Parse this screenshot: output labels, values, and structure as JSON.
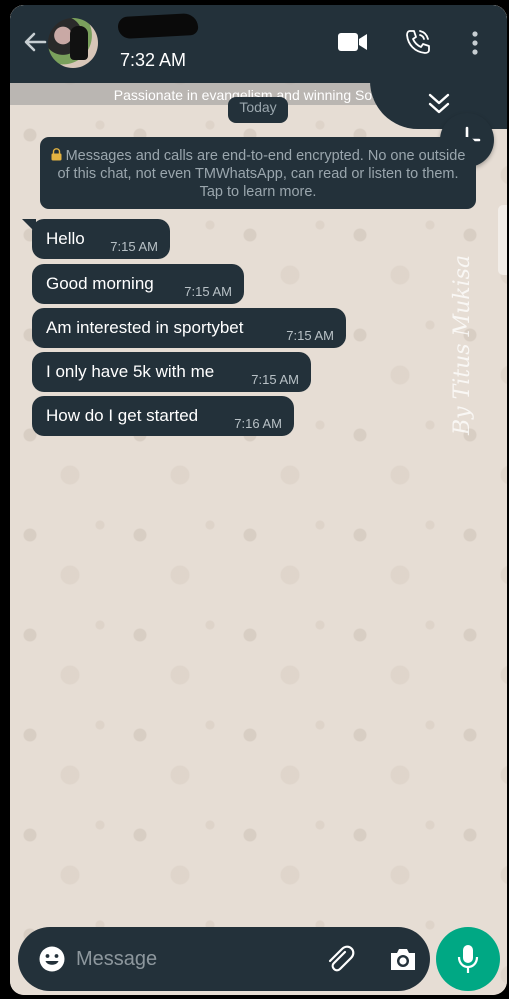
{
  "header": {
    "time": "7:32 AM",
    "status_text": "Passionate in evangelism and winning Soul for"
  },
  "chat": {
    "date_label": "Today",
    "encryption_notice": "Messages and calls are end-to-end encrypted. No one outside of this chat, not even TMWhatsApp, can read or listen to them. Tap to learn more.",
    "messages": [
      {
        "text": "Hello",
        "time": "7:15 AM"
      },
      {
        "text": "Good morning",
        "time": "7:15 AM"
      },
      {
        "text": "Am interested in sportybet",
        "time": "7:15 AM"
      },
      {
        "text": "I only have 5k with me",
        "time": "7:15 AM"
      },
      {
        "text": "How do I get started",
        "time": "7:16 AM"
      }
    ],
    "watermark": "By Titus Mukisa"
  },
  "composer": {
    "placeholder": "Message"
  },
  "colors": {
    "bar": "#23313a",
    "wallpaper": "#e6ddd4",
    "accent": "#00a884"
  },
  "icons": [
    "back-arrow-icon",
    "video-call-icon",
    "voice-call-icon",
    "more-options-icon",
    "double-chevron-down-icon",
    "plus-icon",
    "lock-icon",
    "emoji-icon",
    "attach-icon",
    "camera-icon",
    "mic-icon"
  ]
}
